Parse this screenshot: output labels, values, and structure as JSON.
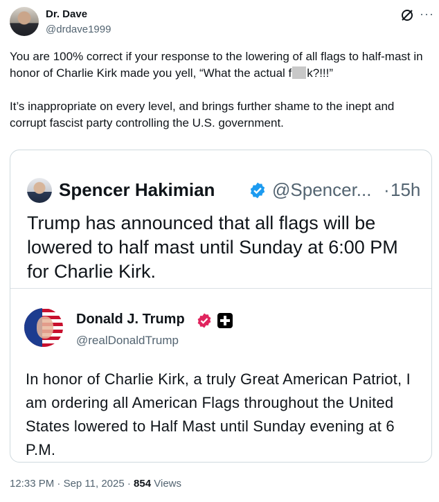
{
  "author": {
    "name": "Dr. Dave",
    "handle": "@drdave1999"
  },
  "post": {
    "paragraph1_a": "You are 100% correct if your response to the lowering of all flags to half-mast in honor of Charlie Kirk made you yell, “What the actual f",
    "paragraph1_b": "k?!!!”",
    "paragraph2": "It’s inappropriate on every level, and brings further shame to the inept and corrupt fascist party controlling the U.S. government."
  },
  "quote": {
    "name": "Spencer Hakimian",
    "handle": "@Spencer...",
    "separator": "·",
    "time": "15h",
    "text": "Trump has announced that all flags will be lowered to half mast until Sunday at 6:00 PM for Charlie Kirk."
  },
  "embedded": {
    "name": "Donald J. Trump",
    "handle": "@realDonaldTrump",
    "text": "In honor of Charlie Kirk, a truly Great American Patriot, I am ordering all American Flags throughout the United States lowered to Half Mast until Sunday evening at 6 P.M."
  },
  "footer": {
    "time": "12:33 PM",
    "sep1": "·",
    "date": "Sep 11, 2025",
    "sep2": "·",
    "views_count": "854",
    "views_label": "Views"
  },
  "icons": {
    "grok": "grok-icon",
    "more": "more-icon",
    "verified": "verified-badge-icon",
    "affiliate": "affiliate-badge-icon"
  },
  "colors": {
    "verified_blue": "#1d9bf0",
    "verified_pink": "#e0245e",
    "secondary_text": "#536471"
  }
}
